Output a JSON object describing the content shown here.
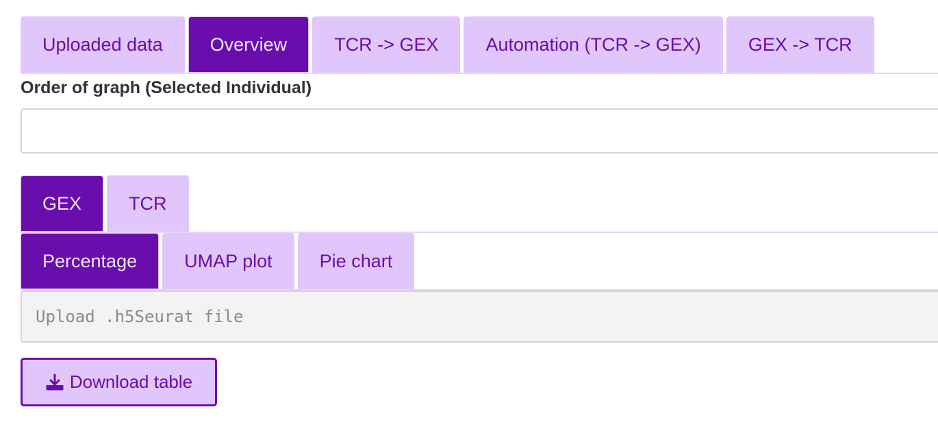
{
  "main_tabs": [
    {
      "label": "Uploaded data",
      "active": false
    },
    {
      "label": "Overview",
      "active": true
    },
    {
      "label": "TCR -> GEX",
      "active": false
    },
    {
      "label": "Automation (TCR -> GEX)",
      "active": false
    },
    {
      "label": "GEX -> TCR",
      "active": false
    }
  ],
  "order_graph": {
    "label": "Order of graph (Selected Individual)",
    "value": ""
  },
  "data_tabs": [
    {
      "label": "GEX",
      "active": true
    },
    {
      "label": "TCR",
      "active": false
    }
  ],
  "view_tabs": [
    {
      "label": "Percentage",
      "active": true
    },
    {
      "label": "UMAP plot",
      "active": false
    },
    {
      "label": "Pie chart",
      "active": false
    }
  ],
  "upload": {
    "placeholder": "Upload .h5Seurat file"
  },
  "download": {
    "label": "Download table",
    "icon": "download-icon"
  },
  "colors": {
    "accent": "#6a0dad",
    "tab_bg": "#e1c6fb",
    "active_text": "#f3e6ff"
  }
}
